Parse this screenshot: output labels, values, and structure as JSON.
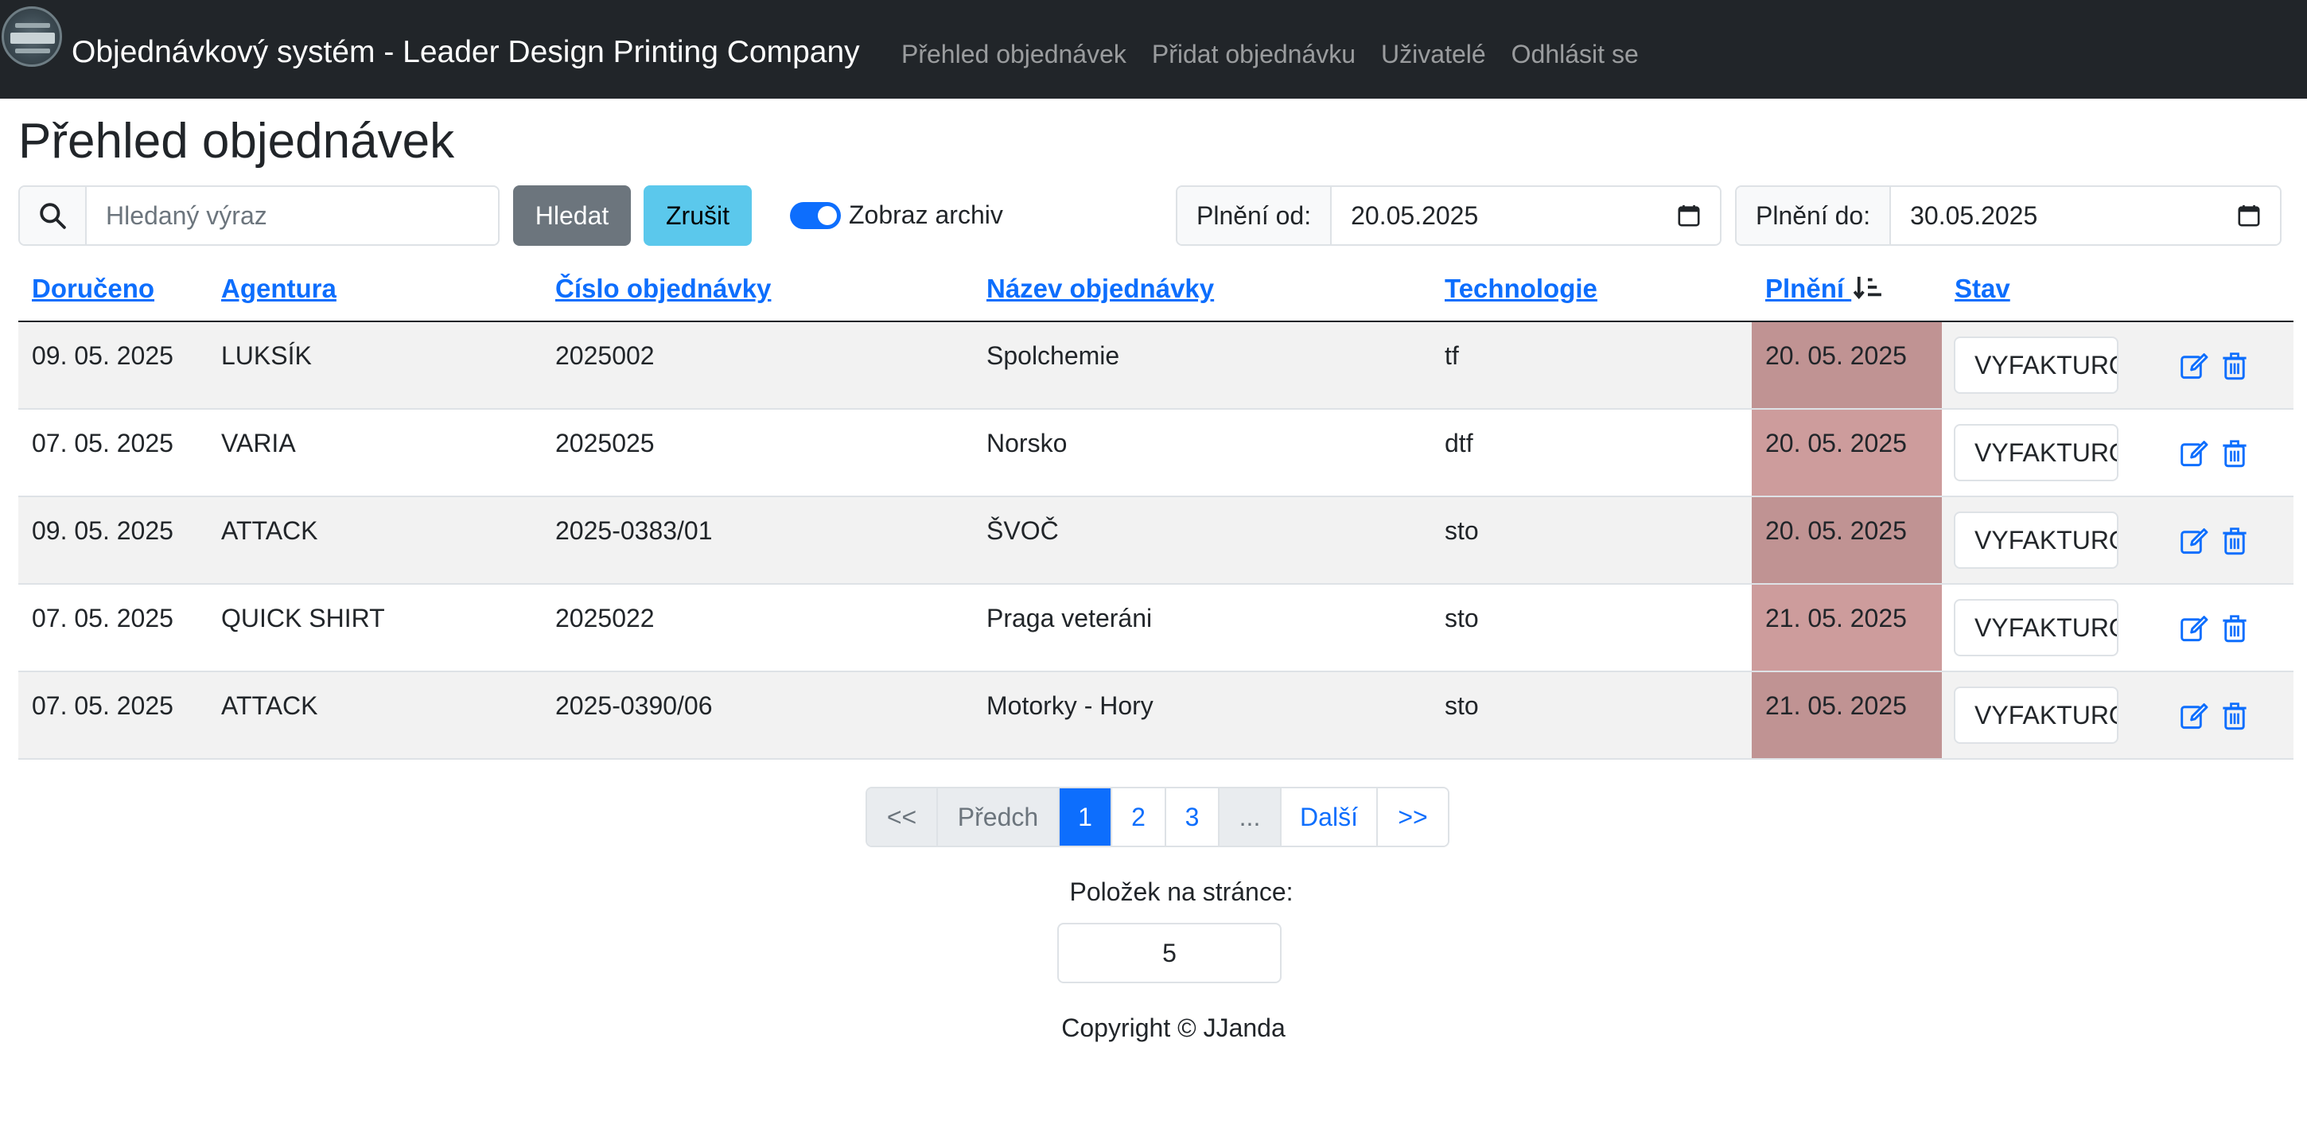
{
  "navbar": {
    "brand": "Objednávkový systém - Leader Design Printing Company",
    "links": [
      "Přehled objednávek",
      "Přidat objednávku",
      "Uživatelé",
      "Odhlásit se"
    ]
  },
  "page_title": "Přehled objednávek",
  "search": {
    "placeholder": "Hledaný výraz",
    "value": "",
    "search_button": "Hledat",
    "cancel_button": "Zrušit"
  },
  "archive_toggle": {
    "label": "Zobraz archiv",
    "checked": true
  },
  "date_from": {
    "label": "Plnění od:",
    "value": "20.05.2025"
  },
  "date_to": {
    "label": "Plnění do:",
    "value": "30.05.2025"
  },
  "table": {
    "columns": [
      "Doručeno",
      "Agentura",
      "Číslo objednávky",
      "Název objednávky",
      "Technologie",
      "Plnění",
      "Stav"
    ],
    "rows": [
      {
        "doruceno": "09. 05. 2025",
        "agentura": "LUKSÍK",
        "cislo": "2025002",
        "nazev": "Spolchemie",
        "technologie": "tf",
        "plneni": "20. 05. 2025",
        "stav": "VYFAKTUROVÁNO"
      },
      {
        "doruceno": "07. 05. 2025",
        "agentura": "VARIA",
        "cislo": "2025025",
        "nazev": "Norsko",
        "technologie": "dtf",
        "plneni": "20. 05. 2025",
        "stav": "VYFAKTUROVÁNO"
      },
      {
        "doruceno": "09. 05. 2025",
        "agentura": "ATTACK",
        "cislo": "2025-0383/01",
        "nazev": "ŠVOČ",
        "technologie": "sto",
        "plneni": "20. 05. 2025",
        "stav": "VYFAKTUROVÁNO"
      },
      {
        "doruceno": "07. 05. 2025",
        "agentura": "QUICK SHIRT",
        "cislo": "2025022",
        "nazev": "Praga veteráni",
        "technologie": "sto",
        "plneni": "21. 05. 2025",
        "stav": "VYFAKTUROVÁNO"
      },
      {
        "doruceno": "07. 05. 2025",
        "agentura": "ATTACK",
        "cislo": "2025-0390/06",
        "nazev": "Motorky - Hory",
        "technologie": "sto",
        "plneni": "21. 05. 2025",
        "stav": "VYFAKTUROVÁNO"
      }
    ]
  },
  "pagination": {
    "first": "<<",
    "prev": "Předch",
    "pages": [
      "1",
      "2",
      "3"
    ],
    "active_page": "1",
    "ellipsis": "...",
    "next": "Další",
    "last": ">>"
  },
  "per_page": {
    "label": "Položek na stránce:",
    "value": "5"
  },
  "footer": "Copyright © JJanda",
  "colors": {
    "navbar_bg": "#212529",
    "primary": "#0d6efd",
    "secondary": "#6c757d",
    "info": "#5bc8ec",
    "overdue_cell_odd": "#c09393",
    "overdue_cell_even": "#cd9c9c"
  },
  "icons": {
    "search": "search-icon",
    "sort": "sort-descending-icon",
    "edit": "edit-icon",
    "delete": "trash-icon"
  }
}
